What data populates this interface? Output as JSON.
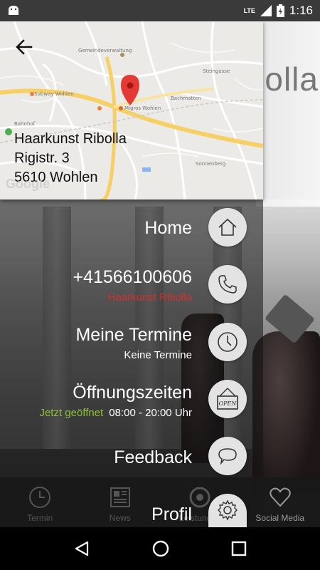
{
  "status_bar": {
    "network": "LTE",
    "time": "1:16"
  },
  "map": {
    "address_lines": [
      "Haarkunst Ribolla",
      "Rigistr. 3",
      "5610 Wohlen"
    ],
    "labels": [
      "Gemeindeverwaltung",
      "Subway Wohlen",
      "Migros Wohlen",
      "Bahnhof",
      "Steingasse",
      "Bachmatten",
      "Sonnenberg"
    ],
    "watermark": "Google"
  },
  "background": {
    "brand_text": "bolla"
  },
  "menu": {
    "home": {
      "label": "Home"
    },
    "phone": {
      "label": "+41566100606",
      "sub": "Haarkunst Ribolla"
    },
    "termine": {
      "label": "Meine Termine",
      "sub": "Keine Termine"
    },
    "hours": {
      "label": "Öffnungszeiten",
      "status": "Jetzt geöffnet",
      "time": "08:00 - 20:00 Uhr",
      "sign_text": "OPEN"
    },
    "feedback": {
      "label": "Feedback"
    },
    "profil": {
      "label": "Profil"
    }
  },
  "tabs": [
    {
      "label": "Termin"
    },
    {
      "label": "News"
    },
    {
      "label": "Leistungen"
    },
    {
      "label": "Social Media"
    }
  ],
  "colors": {
    "accent_red": "#d0312d",
    "accent_green": "#8fbf3a",
    "map_pin": "#e53935"
  }
}
